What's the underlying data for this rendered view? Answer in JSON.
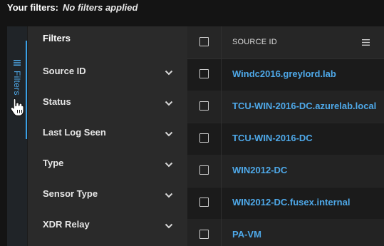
{
  "filters_bar": {
    "label": "Your filters:",
    "value": "No filters applied"
  },
  "side_tab": {
    "label": "Filters",
    "accent_color": "#3aa0e6"
  },
  "filter_panel": {
    "title": "Filters",
    "items": [
      {
        "label": "Source ID"
      },
      {
        "label": "Status"
      },
      {
        "label": "Last Log Seen"
      },
      {
        "label": "Type"
      },
      {
        "label": "Sensor Type"
      },
      {
        "label": "XDR Relay"
      }
    ]
  },
  "table": {
    "columns": [
      {
        "label": "SOURCE ID"
      }
    ],
    "rows": [
      {
        "source_id": "Windc2016.greylord.lab"
      },
      {
        "source_id": "TCU-WIN-2016-DC.azurelab.local"
      },
      {
        "source_id": "TCU-WIN-2016-DC"
      },
      {
        "source_id": "WIN2012-DC"
      },
      {
        "source_id": "WIN2012-DC.fusex.internal"
      },
      {
        "source_id": "PA-VM"
      }
    ],
    "link_color": "#4ea8e8"
  }
}
